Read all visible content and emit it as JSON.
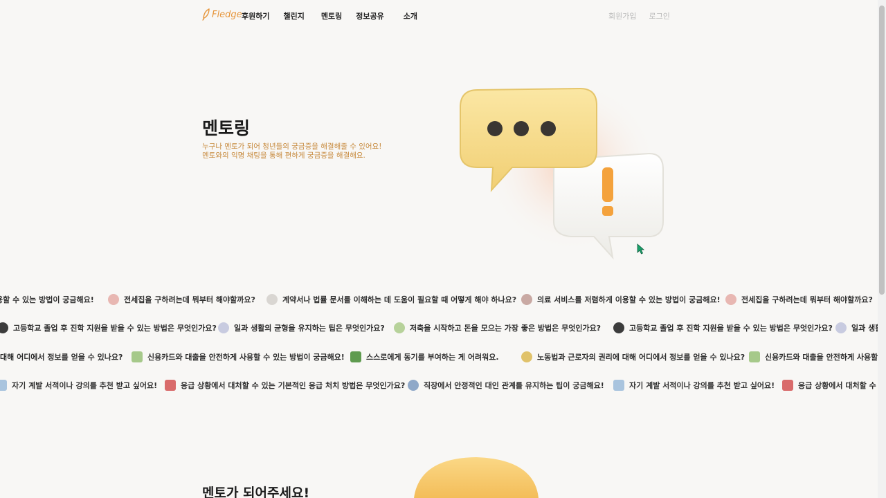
{
  "header": {
    "logo_text": "Fledge",
    "nav": [
      "후원하기",
      "챌린지",
      "멘토링",
      "정보공유",
      "소개"
    ],
    "signup_label": "회원가입",
    "login_label": "로그인"
  },
  "hero": {
    "title": "멘토링",
    "desc_line1": "누구나 멘토가 되어 청년들의 궁금증을 해결해줄 수 있어요!",
    "desc_line2": "멘토와의 익명 채팅을 통해 편하게 궁금증을 해결해요."
  },
  "question_rows": [
    [
      "용할 수 있는 방법이 궁금해요!",
      "전세집을 구하려는데 뭐부터 해야할까요?",
      "계약서나 법률 문서를 이해하는 데 도움이 필요할 때 어떻게 해야 하나요?",
      "의료 서비스를 저렴하게 이용할 수 있는 방법이 궁금해요!",
      "전세집을 구하려는데 뭐부터 해야할까요?"
    ],
    [
      "고등학교 졸업 후 진학 지원을 받을 수 있는 방법은 무엇인가요?",
      "일과 생활의 균형을 유지하는 팁은 무엇인가요?",
      "저축을 시작하고 돈을 모으는 가장 좋은 방법은 무엇인가요?",
      "고등학교 졸업 후 진학 지원을 받을 수 있는 방법은 무엇인가요?",
      "일과 생활"
    ],
    [
      "대해 어디에서 정보를 얻을 수 있나요?",
      "신용카드와 대출을 안전하게 사용할 수 있는 방법이 궁금해요!",
      "스스로에게 동기를 부여하는 게 어려워요.",
      "노동법과 근로자의 권리에 대해 어디에서 정보를 얻을 수 있나요?",
      "신용카드와 대출을 안전하게 사용할 수 있"
    ],
    [
      "자기 계발 서적이나 강의를 추천 받고 싶어요!",
      "응급 상황에서 대처할 수 있는 기본적인 응급 처치 방법은 무엇인가요?",
      "직장에서 안정적인 대인 관계를 유지하는 팁이 궁금해요!",
      "자기 계발 서적이나 강의를 추천 받고 싶어요!",
      "응급 상황에서 대처할 수 있"
    ]
  ],
  "section2": {
    "title": "멘토가 되어주세요!"
  },
  "colors": {
    "accent": "#e6953a",
    "desc_text": "#c78a3d",
    "muted": "#b9b9b9",
    "background": "#f8f7f5"
  }
}
